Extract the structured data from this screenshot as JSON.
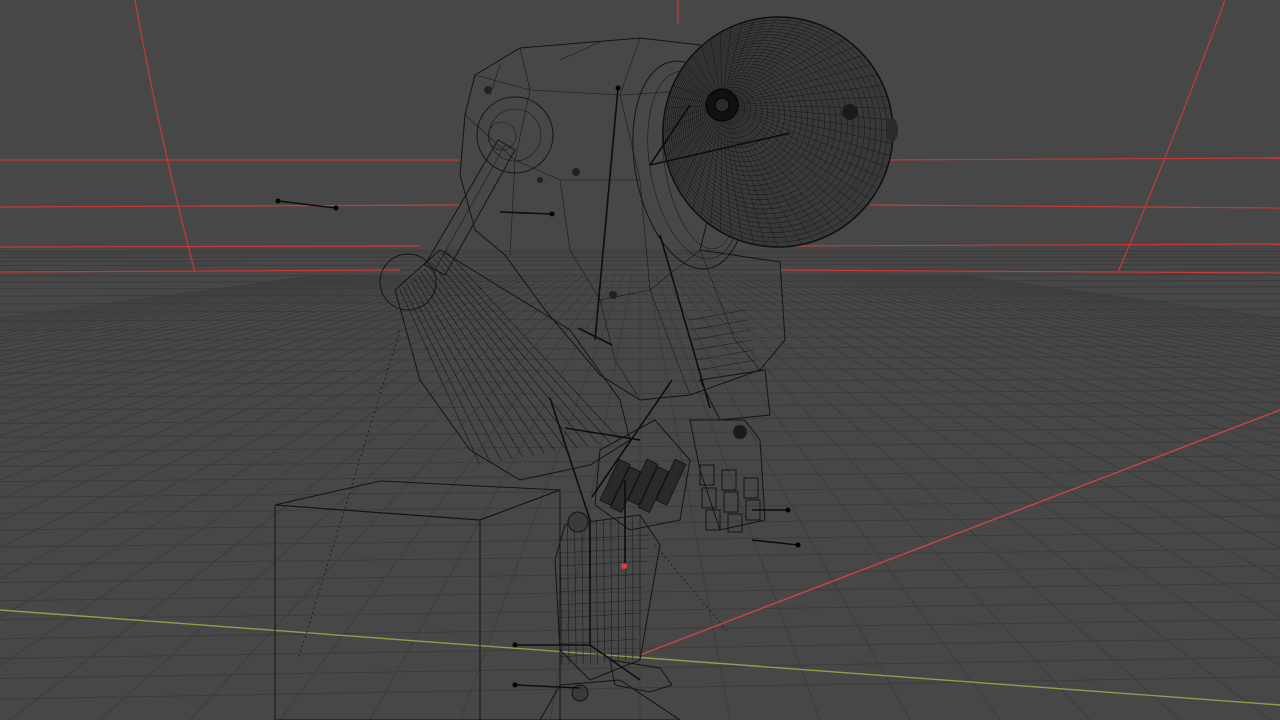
{
  "viewport": {
    "background_color": "#474747",
    "grid_color": "#3c3c3c",
    "x_axis_color": "#c94545",
    "y_axis_color": "#86a34a",
    "wire_color": "#141414",
    "bounds_color": "#c63a3a"
  },
  "scene": {
    "objects": [
      "robot-character",
      "cube",
      "armature"
    ],
    "display_mode": "wireframe"
  }
}
